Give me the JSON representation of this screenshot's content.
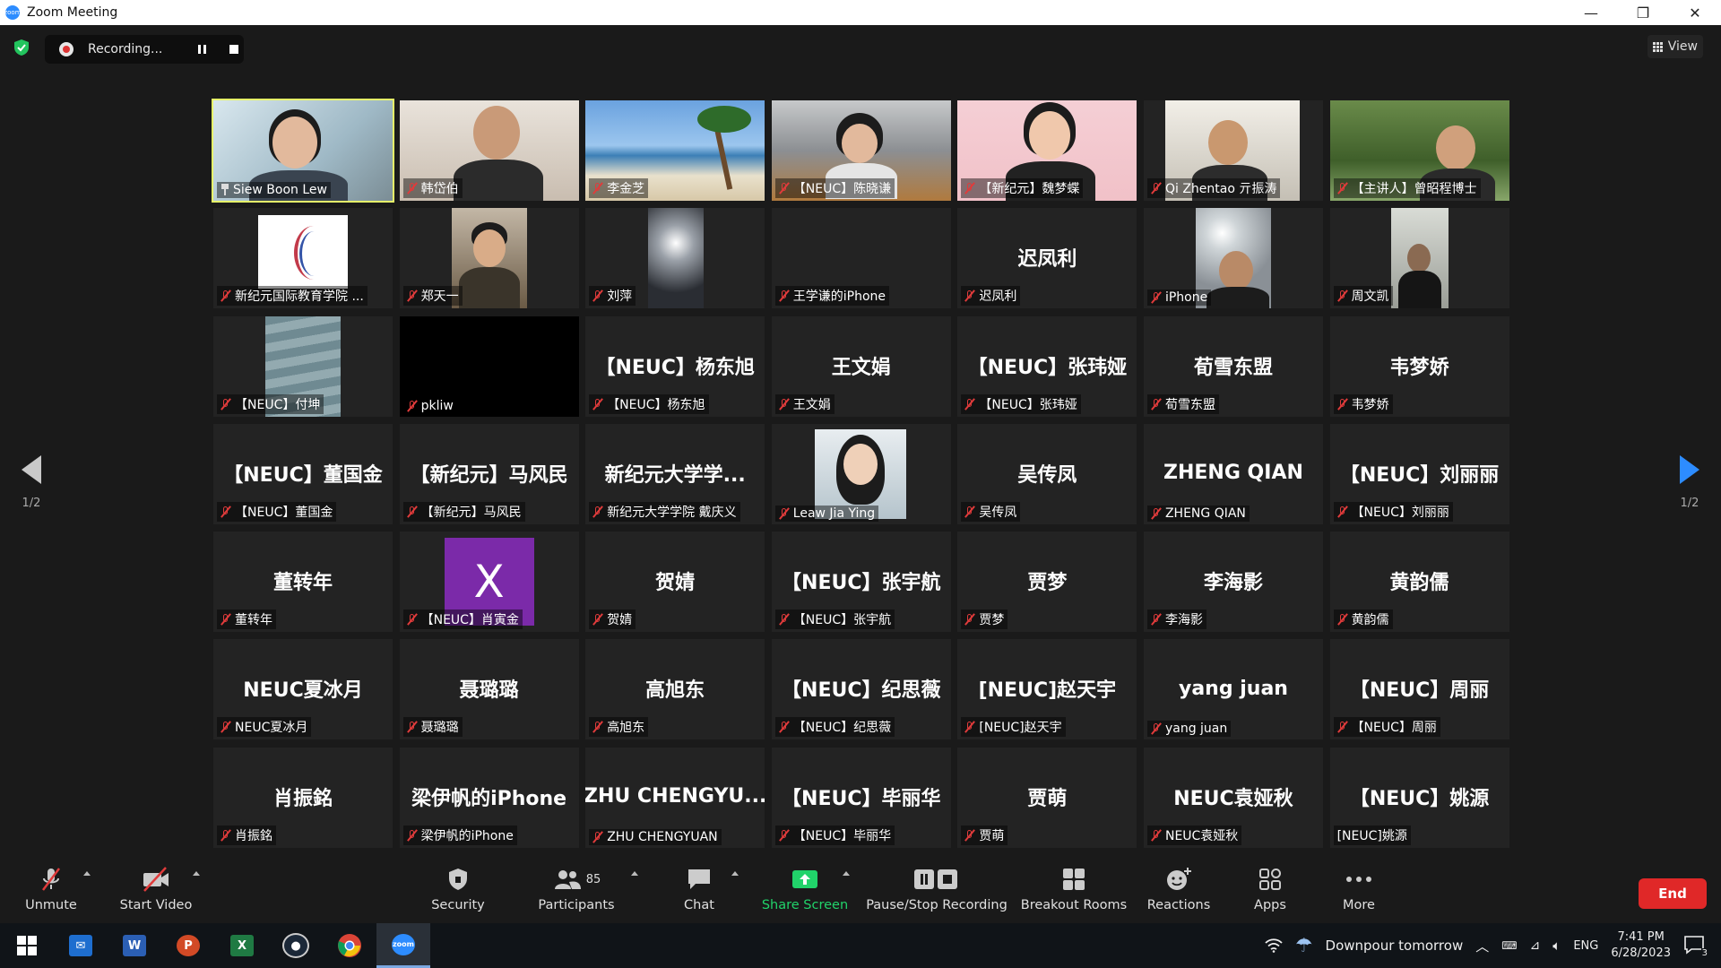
{
  "window": {
    "title": "Zoom Meeting",
    "minimize": "—",
    "maximize": "❐",
    "close": "✕"
  },
  "recording": {
    "label": "Recording..."
  },
  "view_button": {
    "label": "View"
  },
  "pagination": {
    "left": "1/2",
    "right": "1/2"
  },
  "tiles": [
    {
      "name": "Siew Boon Lew",
      "center": "",
      "video": "person-bg",
      "muted": false,
      "pinned": true,
      "active": true
    },
    {
      "name": "韩岱伯",
      "center": "",
      "video": "room",
      "muted": true
    },
    {
      "name": "李金芝",
      "center": "",
      "video": "beach",
      "muted": true
    },
    {
      "name": "【NEUC】陈晓谦",
      "center": "",
      "video": "ink",
      "muted": true
    },
    {
      "name": "【新纪元】魏梦蝶",
      "center": "",
      "video": "pink",
      "muted": true
    },
    {
      "name": "Qi Zhentao 亓振涛",
      "center": "",
      "video": "office",
      "muted": true
    },
    {
      "name": "【主讲人】曾昭程博士",
      "center": "",
      "video": "park",
      "muted": true
    },
    {
      "name": "新纪元国际教育学院 ...",
      "center": "",
      "video": "logo",
      "muted": true
    },
    {
      "name": "郑天一",
      "center": "",
      "video": "inset-person",
      "muted": true
    },
    {
      "name": "刘萍",
      "center": "",
      "video": "inset-light",
      "muted": true
    },
    {
      "name": "王学谦的iPhone",
      "center": "",
      "video": "none",
      "muted": true
    },
    {
      "name": "迟凤利",
      "center": "迟凤利",
      "video": "none",
      "muted": true
    },
    {
      "name": "iPhone",
      "center": "",
      "video": "inset-man",
      "muted": true
    },
    {
      "name": "周文凯",
      "center": "",
      "video": "inset-dark",
      "muted": true
    },
    {
      "name": "【NEUC】付坤",
      "center": "",
      "video": "inset-stairs",
      "muted": true
    },
    {
      "name": "pkliw",
      "center": "",
      "video": "black",
      "muted": true
    },
    {
      "name": "【NEUC】杨东旭",
      "center": "【NEUC】杨东旭",
      "video": "none",
      "muted": true
    },
    {
      "name": "王文娟",
      "center": "王文娟",
      "video": "none",
      "muted": true
    },
    {
      "name": "【NEUC】张玮娅",
      "center": "【NEUC】张玮娅",
      "video": "none",
      "muted": true
    },
    {
      "name": "荀雪东盟",
      "center": "荀雪东盟",
      "video": "none",
      "muted": true
    },
    {
      "name": "韦梦娇",
      "center": "韦梦娇",
      "video": "none",
      "muted": true
    },
    {
      "name": "【NEUC】董国金",
      "center": "【NEUC】董国金",
      "video": "none",
      "muted": true
    },
    {
      "name": "【新纪元】马风民",
      "center": "【新纪元】马风民",
      "video": "none",
      "muted": true
    },
    {
      "name": "新纪元大学学院 戴庆义",
      "center": "新纪元大学学...",
      "video": "none",
      "muted": true
    },
    {
      "name": "Leaw Jia Ying",
      "center": "",
      "video": "inset-woman",
      "muted": true
    },
    {
      "name": "吴传凤",
      "center": "吴传凤",
      "video": "none",
      "muted": true
    },
    {
      "name": "ZHENG QIAN",
      "center": "ZHENG QIAN",
      "video": "none",
      "muted": true
    },
    {
      "name": "【NEUC】刘丽丽",
      "center": "【NEUC】刘丽丽",
      "video": "none",
      "muted": true
    },
    {
      "name": "董转年",
      "center": "董转年",
      "video": "none",
      "muted": true
    },
    {
      "name": "【NEUC】肖寅金",
      "center": "",
      "video": "x",
      "muted": true,
      "avatar_letter": "X"
    },
    {
      "name": "贺婧",
      "center": "贺婧",
      "video": "none",
      "muted": true
    },
    {
      "name": "【NEUC】张宇航",
      "center": "【NEUC】张宇航",
      "video": "none",
      "muted": true
    },
    {
      "name": "贾梦",
      "center": "贾梦",
      "video": "none",
      "muted": true
    },
    {
      "name": "李海影",
      "center": "李海影",
      "video": "none",
      "muted": true
    },
    {
      "name": "黄韵儒",
      "center": "黄韵儒",
      "video": "none",
      "muted": true
    },
    {
      "name": "NEUC夏冰月",
      "center": "NEUC夏冰月",
      "video": "none",
      "muted": true
    },
    {
      "name": "聂璐璐",
      "center": "聂璐璐",
      "video": "none",
      "muted": true
    },
    {
      "name": "高旭东",
      "center": "高旭东",
      "video": "none",
      "muted": true
    },
    {
      "name": "【NEUC】纪思薇",
      "center": "【NEUC】纪思薇",
      "video": "none",
      "muted": true
    },
    {
      "name": "[NEUC]赵天宇",
      "center": "[NEUC]赵天宇",
      "video": "none",
      "muted": true
    },
    {
      "name": "yang juan",
      "center": "yang juan",
      "video": "none",
      "muted": true
    },
    {
      "name": "【NEUC】周丽",
      "center": "【NEUC】周丽",
      "video": "none",
      "muted": true
    },
    {
      "name": "肖振銘",
      "center": "肖振銘",
      "video": "none",
      "muted": true
    },
    {
      "name": "梁伊帆的iPhone",
      "center": "梁伊帆的iPhone",
      "video": "none",
      "muted": true
    },
    {
      "name": "ZHU CHENGYUAN",
      "center": "ZHU CHENGYU...",
      "video": "none",
      "muted": true
    },
    {
      "name": "【NEUC】毕丽华",
      "center": "【NEUC】毕丽华",
      "video": "none",
      "muted": true
    },
    {
      "name": "贾萌",
      "center": "贾萌",
      "video": "none",
      "muted": true
    },
    {
      "name": "NEUC袁娅秋",
      "center": "NEUC袁娅秋",
      "video": "none",
      "muted": true
    },
    {
      "name": "[NEUC]姚源",
      "center": "【NEUC】姚源",
      "video": "none",
      "muted": false
    }
  ],
  "toolbar": {
    "unmute": "Unmute",
    "start_video": "Start Video",
    "security": "Security",
    "participants": "Participants",
    "participants_count": "85",
    "chat": "Chat",
    "share_screen": "Share Screen",
    "pause_stop_recording": "Pause/Stop Recording",
    "breakout_rooms": "Breakout Rooms",
    "reactions": "Reactions",
    "apps": "Apps",
    "more": "More",
    "end": "End"
  },
  "taskbar": {
    "weather": "Downpour tomorrow",
    "language": "ENG",
    "time": "7:41 PM",
    "date": "6/28/2023",
    "notifications": "3"
  },
  "colors": {
    "accent_blue": "#2d8cff",
    "share_green": "#21d36a",
    "end_red": "#e02828",
    "active_outline": "#e6f56a",
    "mute_red": "#e03b3b"
  }
}
